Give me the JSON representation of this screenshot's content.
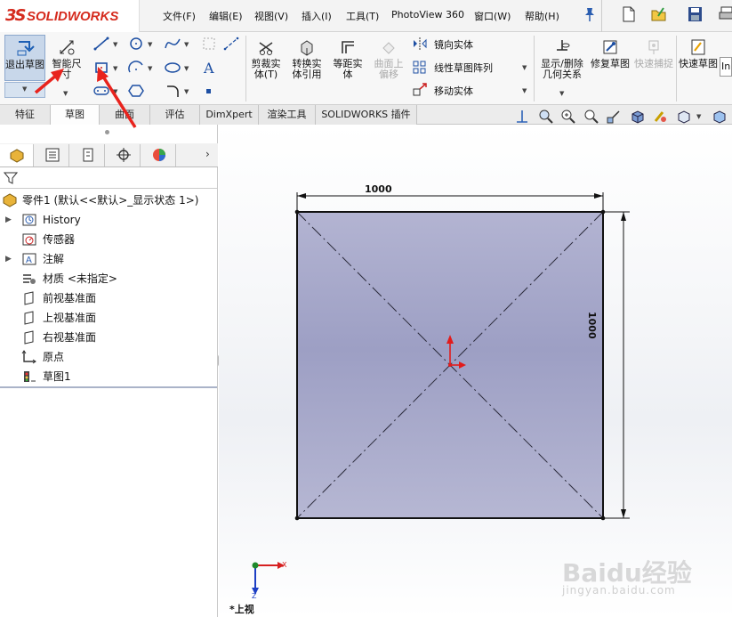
{
  "app": {
    "logo_mark": "3S",
    "logo_text": "SOLIDWORKS",
    "accent": "#d52b1e"
  },
  "menu": [
    "文件(F)",
    "编辑(E)",
    "视图(V)",
    "插入(I)",
    "工具(T)",
    "PhotoView 360",
    "窗口(W)",
    "帮助(H)"
  ],
  "toolbar": {
    "exit_sketch": "退出草图",
    "smart_dimension": "智能尺寸",
    "trim_entities": "剪裁实体(T)",
    "convert_entities": "转换实体引用",
    "offset_entities": "等距实体",
    "offset_on_surface": "曲面上偏移",
    "mirror_entities": "镜向实体",
    "linear_pattern": "线性草图阵列",
    "move_entities": "移动实体",
    "display_relations": "显示/删除几何关系",
    "repair_sketch": "修复草图",
    "quick_snaps": "快速捕捉",
    "rapid_sketch": "快速草图",
    "overflow": "In"
  },
  "tabs": [
    "特征",
    "草图",
    "曲面",
    "评估",
    "DimXpert",
    "渲染工具",
    "SOLIDWORKS 插件"
  ],
  "active_tab": "草图",
  "tree": {
    "root": "零件1 (默认<<默认>_显示状态 1>)",
    "items": [
      {
        "label": "History",
        "expandable": true,
        "icon": "history-icon"
      },
      {
        "label": "传感器",
        "expandable": false,
        "icon": "sensor-icon"
      },
      {
        "label": "注解",
        "expandable": true,
        "icon": "annotation-icon"
      },
      {
        "label": "材质 <未指定>",
        "expandable": false,
        "icon": "material-icon"
      },
      {
        "label": "前视基准面",
        "expandable": false,
        "icon": "plane-icon"
      },
      {
        "label": "上视基准面",
        "expandable": false,
        "icon": "plane-icon"
      },
      {
        "label": "右视基准面",
        "expandable": false,
        "icon": "plane-icon"
      },
      {
        "label": "原点",
        "expandable": false,
        "icon": "origin-icon"
      },
      {
        "label": "草图1",
        "expandable": false,
        "icon": "sketch-icon"
      }
    ]
  },
  "sketch": {
    "width_dimension": "1000",
    "height_dimension": "1000",
    "fill_color": "#9fa1c6",
    "line_color": "#111111"
  },
  "triad": {
    "x_label": "X",
    "z_label": "Z",
    "view_name": "*上视"
  },
  "watermark": {
    "brand": "Baidu经验",
    "url": "jingyan.baidu.com"
  }
}
